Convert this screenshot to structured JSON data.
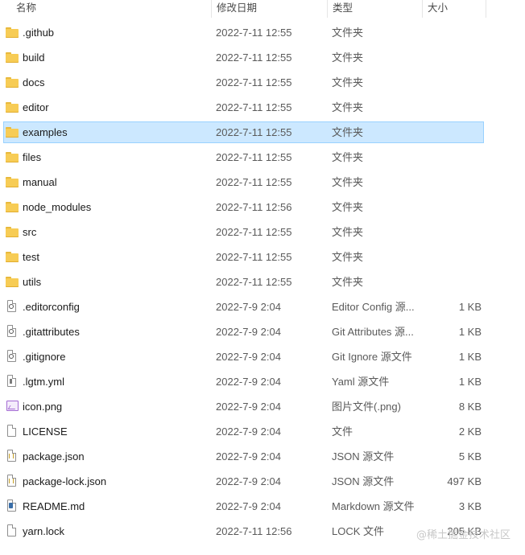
{
  "columns": {
    "name": "名称",
    "date": "修改日期",
    "type": "类型",
    "size": "大小"
  },
  "selected_index": 4,
  "files": [
    {
      "icon": "folder-icon",
      "name": ".github",
      "date": "2022-7-11 12:55",
      "type": "文件夹",
      "size": ""
    },
    {
      "icon": "folder-icon",
      "name": "build",
      "date": "2022-7-11 12:55",
      "type": "文件夹",
      "size": ""
    },
    {
      "icon": "folder-icon",
      "name": "docs",
      "date": "2022-7-11 12:55",
      "type": "文件夹",
      "size": ""
    },
    {
      "icon": "folder-icon",
      "name": "editor",
      "date": "2022-7-11 12:55",
      "type": "文件夹",
      "size": ""
    },
    {
      "icon": "folder-icon",
      "name": "examples",
      "date": "2022-7-11 12:55",
      "type": "文件夹",
      "size": ""
    },
    {
      "icon": "folder-icon",
      "name": "files",
      "date": "2022-7-11 12:55",
      "type": "文件夹",
      "size": ""
    },
    {
      "icon": "folder-icon",
      "name": "manual",
      "date": "2022-7-11 12:55",
      "type": "文件夹",
      "size": ""
    },
    {
      "icon": "folder-icon",
      "name": "node_modules",
      "date": "2022-7-11 12:56",
      "type": "文件夹",
      "size": ""
    },
    {
      "icon": "folder-icon",
      "name": "src",
      "date": "2022-7-11 12:55",
      "type": "文件夹",
      "size": ""
    },
    {
      "icon": "folder-icon",
      "name": "test",
      "date": "2022-7-11 12:55",
      "type": "文件夹",
      "size": ""
    },
    {
      "icon": "folder-icon",
      "name": "utils",
      "date": "2022-7-11 12:55",
      "type": "文件夹",
      "size": ""
    },
    {
      "icon": "config-file-icon",
      "name": ".editorconfig",
      "date": "2022-7-9 2:04",
      "type": "Editor Config 源...",
      "size": "1 KB"
    },
    {
      "icon": "config-file-icon",
      "name": ".gitattributes",
      "date": "2022-7-9 2:04",
      "type": "Git Attributes 源...",
      "size": "1 KB"
    },
    {
      "icon": "config-file-icon",
      "name": ".gitignore",
      "date": "2022-7-9 2:04",
      "type": "Git Ignore 源文件",
      "size": "1 KB"
    },
    {
      "icon": "yaml-file-icon",
      "name": ".lgtm.yml",
      "date": "2022-7-9 2:04",
      "type": "Yaml 源文件",
      "size": "1 KB"
    },
    {
      "icon": "image-file-icon",
      "name": "icon.png",
      "date": "2022-7-9 2:04",
      "type": "图片文件(.png)",
      "size": "8 KB"
    },
    {
      "icon": "blank-file-icon",
      "name": "LICENSE",
      "date": "2022-7-9 2:04",
      "type": "文件",
      "size": "2 KB"
    },
    {
      "icon": "json-file-icon",
      "name": "package.json",
      "date": "2022-7-9 2:04",
      "type": "JSON 源文件",
      "size": "5 KB"
    },
    {
      "icon": "json-file-icon",
      "name": "package-lock.json",
      "date": "2022-7-9 2:04",
      "type": "JSON 源文件",
      "size": "497 KB"
    },
    {
      "icon": "markdown-file-icon",
      "name": "README.md",
      "date": "2022-7-9 2:04",
      "type": "Markdown 源文件",
      "size": "3 KB"
    },
    {
      "icon": "blank-file-icon",
      "name": "yarn.lock",
      "date": "2022-7-11 12:56",
      "type": "LOCK 文件",
      "size": "205 KB"
    }
  ],
  "watermark": "@稀土掘金技术社区"
}
